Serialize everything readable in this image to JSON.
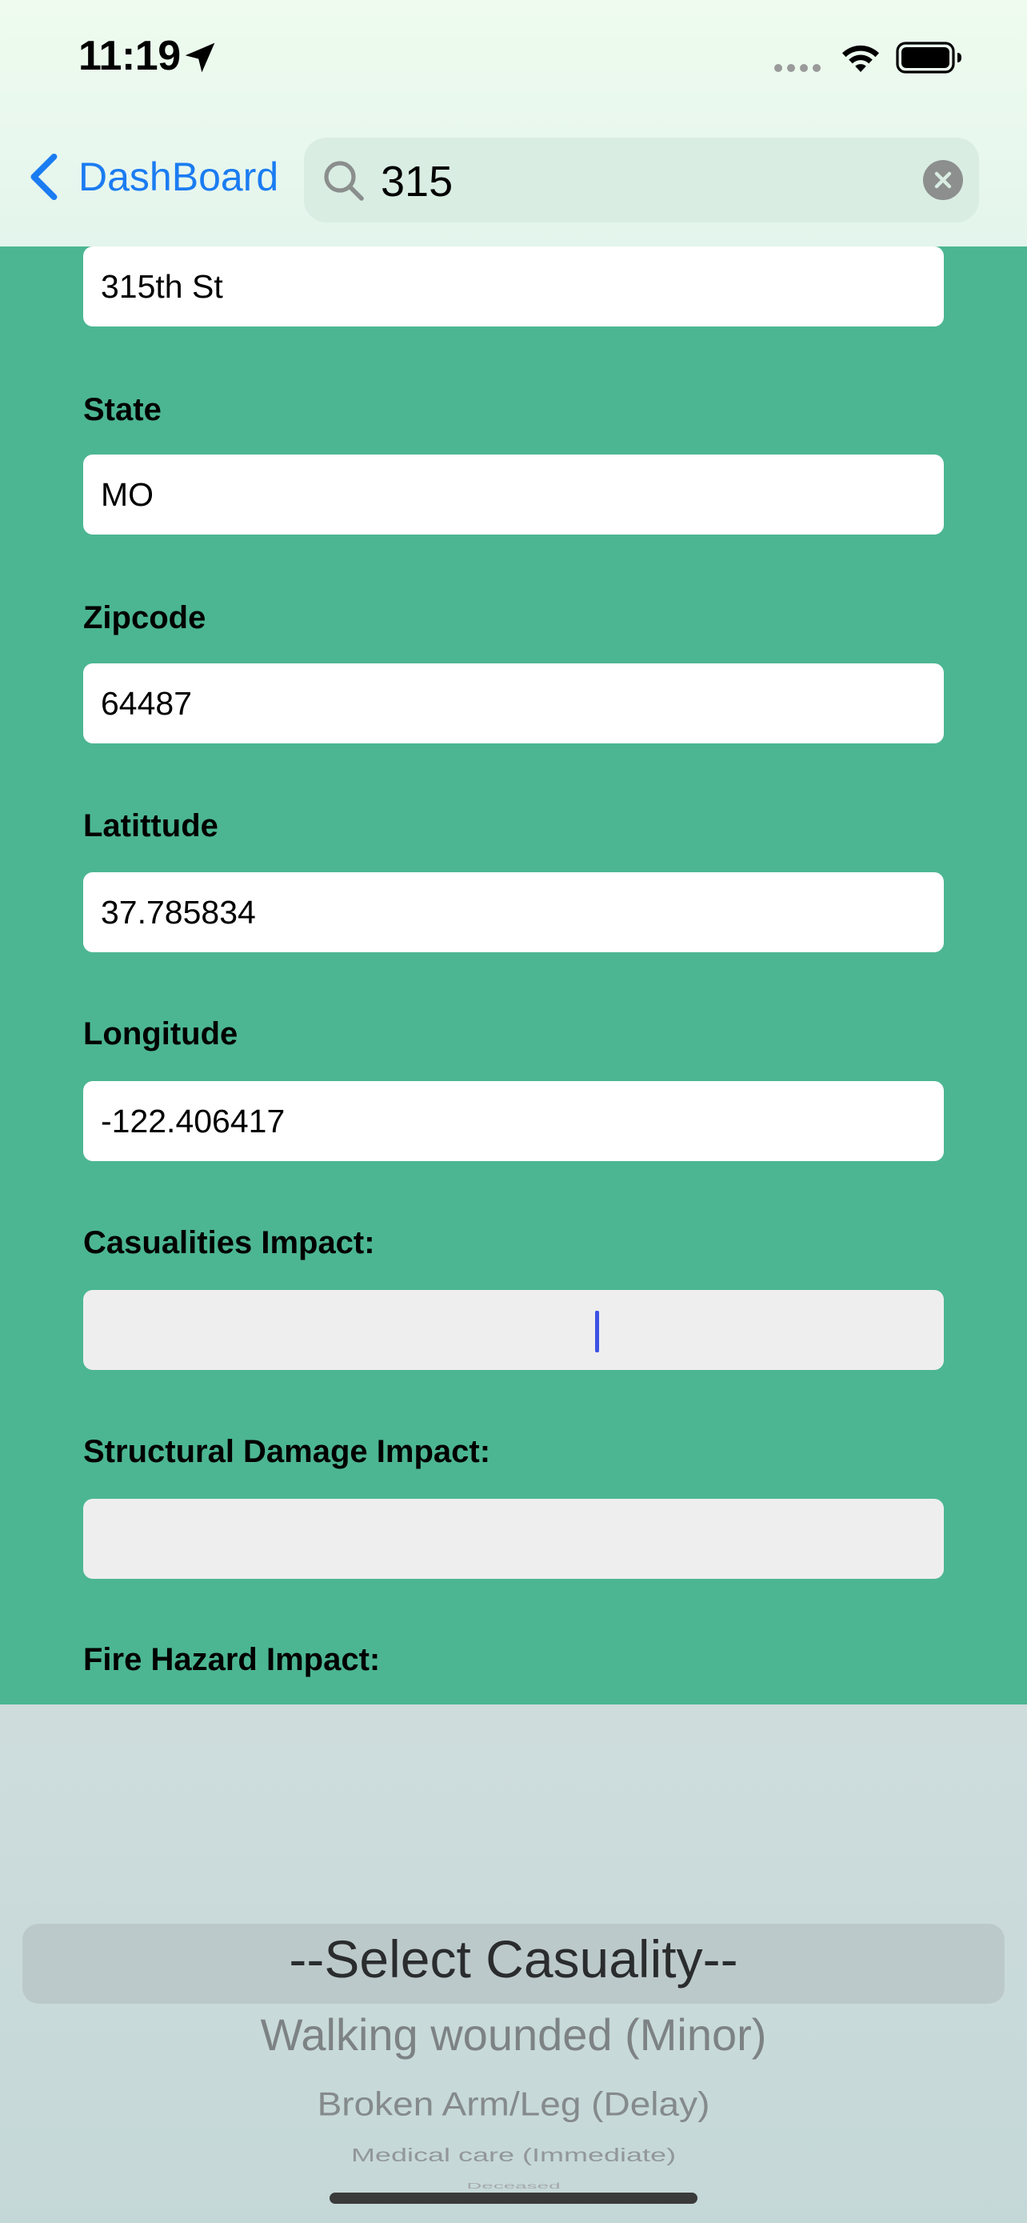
{
  "status_bar": {
    "time": "11:19"
  },
  "nav": {
    "back_label": "DashBoard",
    "search_value": "315"
  },
  "form": {
    "street_value": "315th St",
    "state_label": "State",
    "state_value": "MO",
    "zip_label": "Zipcode",
    "zip_value": "64487",
    "lat_label": "Latittude",
    "lat_value": "37.785834",
    "lon_label": "Longitude",
    "lon_value": "-122.406417",
    "casualities_label": "Casualities Impact:",
    "structural_label": "Structural Damage Impact:",
    "fire_label": "Fire Hazard Impact:"
  },
  "picker": {
    "options": [
      "--Select Casuality--",
      "Walking wounded (Minor)",
      "Broken Arm/Leg (Delay)",
      "Medical care (Immediate)",
      "Deceased"
    ]
  },
  "colors": {
    "background": "#4cb692",
    "accent": "#1b7cf2",
    "cursor": "#3c52e4"
  }
}
